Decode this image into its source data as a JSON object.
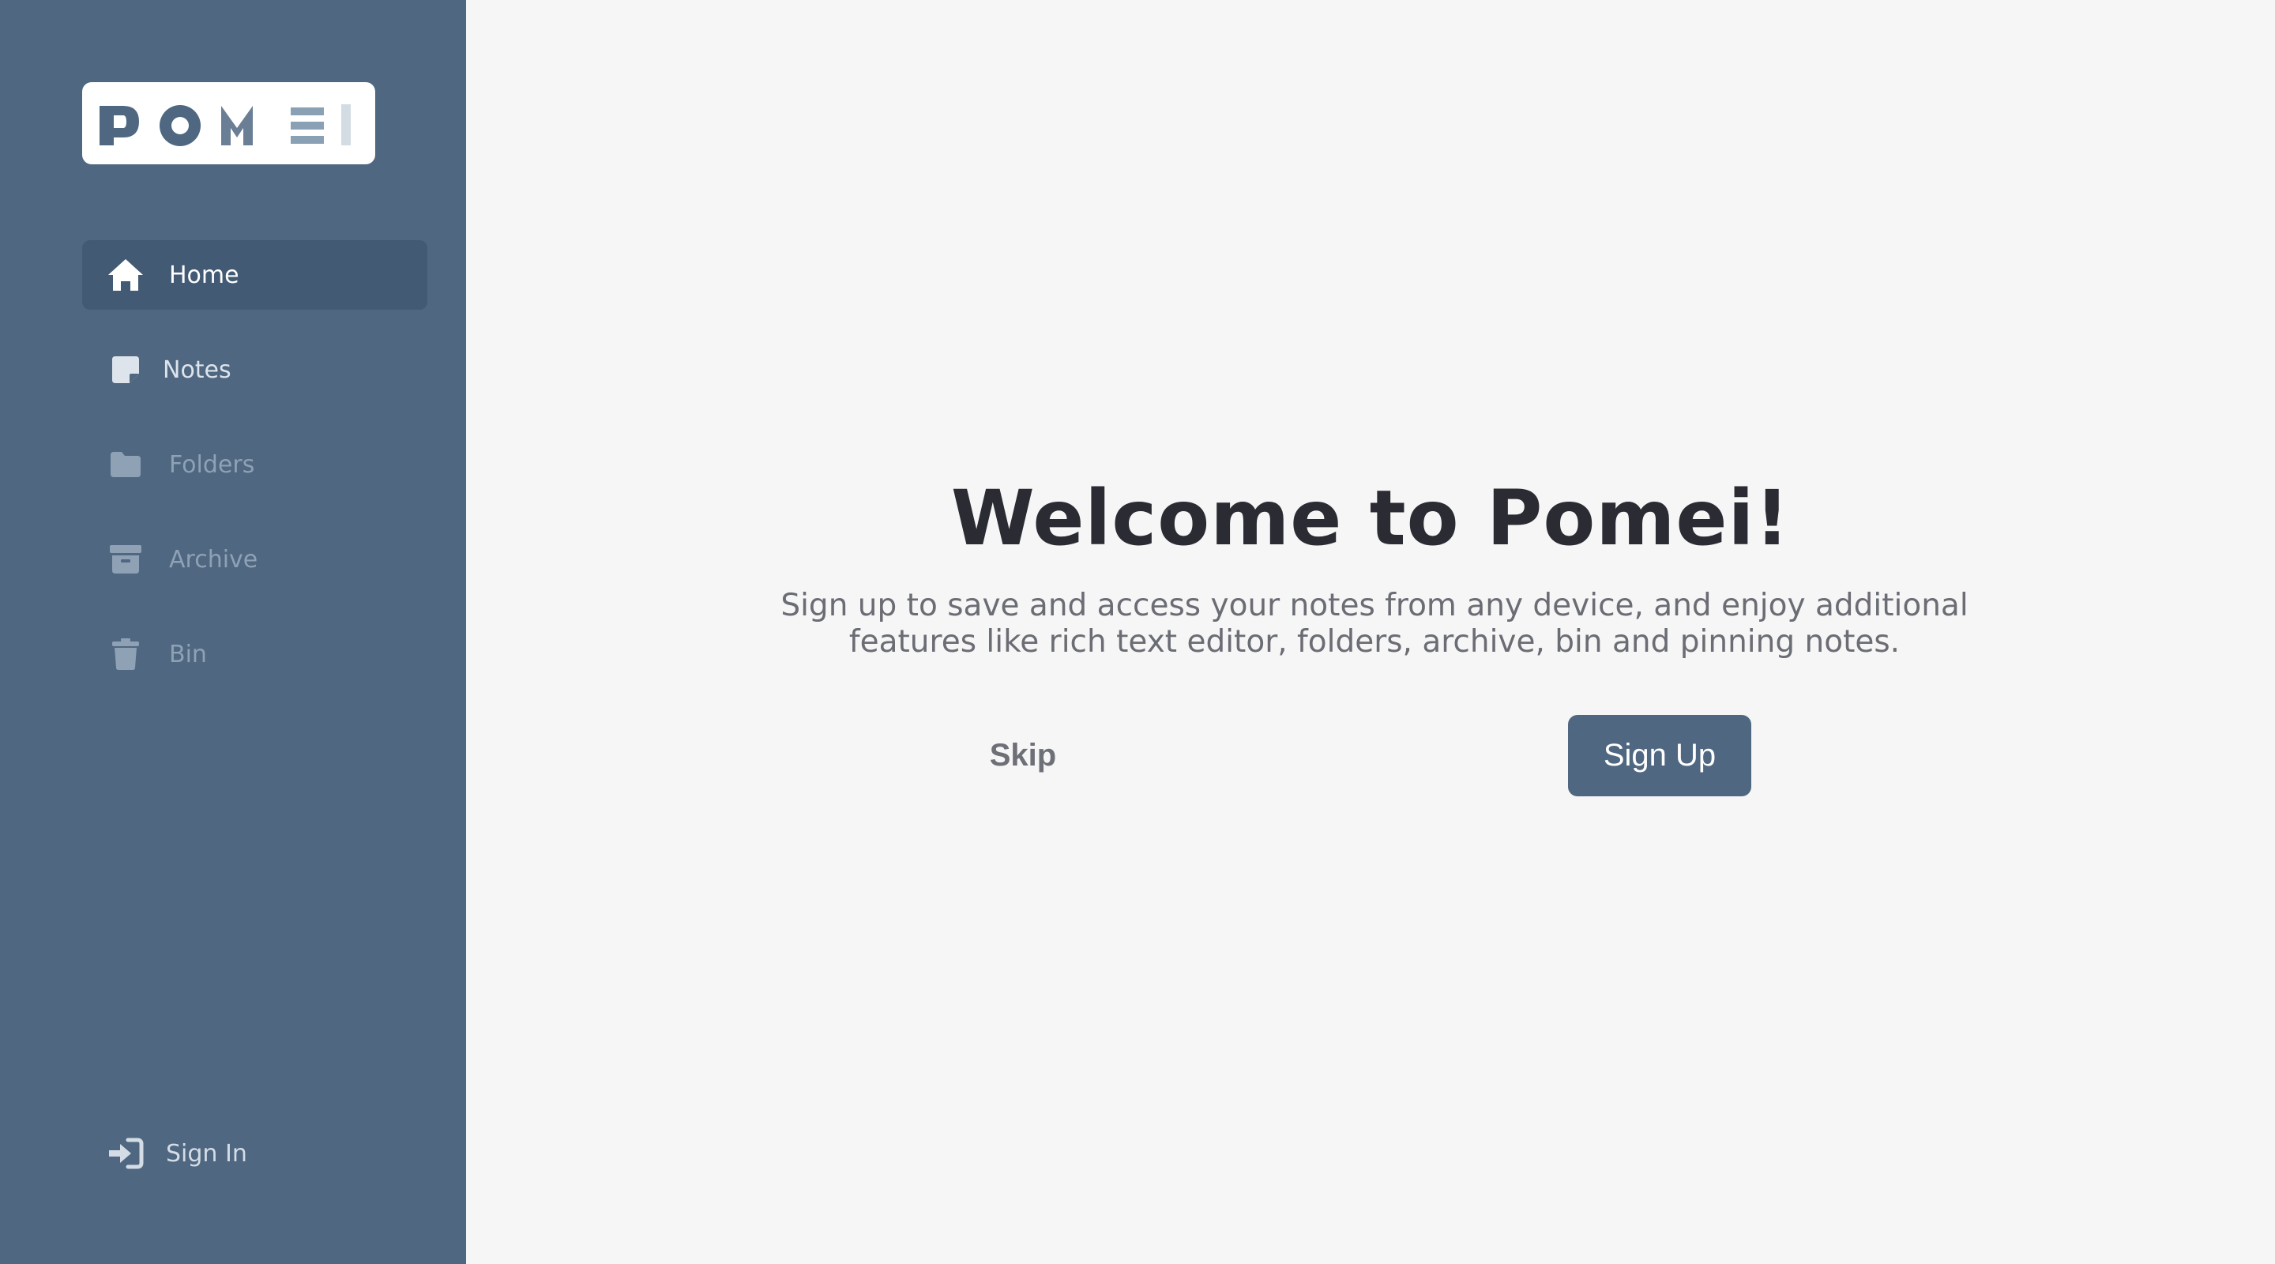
{
  "app": {
    "logo_text": "POMEI",
    "colors": {
      "sidebar": "#4f6781",
      "sidebar_active": "#425a74",
      "background": "#f6f6f6",
      "title": "#2a2b33",
      "primary_button": "#4f6781"
    }
  },
  "sidebar": {
    "items": [
      {
        "label": "Home",
        "icon": "home-icon",
        "active": true
      },
      {
        "label": "Notes",
        "icon": "note-icon",
        "active": false
      },
      {
        "label": "Folders",
        "icon": "folder-icon",
        "active": false
      },
      {
        "label": "Archive",
        "icon": "archive-icon",
        "active": false
      },
      {
        "label": "Bin",
        "icon": "trash-icon",
        "active": false
      }
    ],
    "signin": {
      "label": "Sign In",
      "icon": "sign-in-icon"
    }
  },
  "main": {
    "title": "Welcome to Pomei!",
    "subtitle_line1": "Sign up to save and access your notes from any device, and enjoy additional",
    "subtitle_line2": "features like rich text editor, folders, archive, bin and pinning notes.",
    "skip_label": "Skip",
    "signup_label": "Sign Up"
  }
}
